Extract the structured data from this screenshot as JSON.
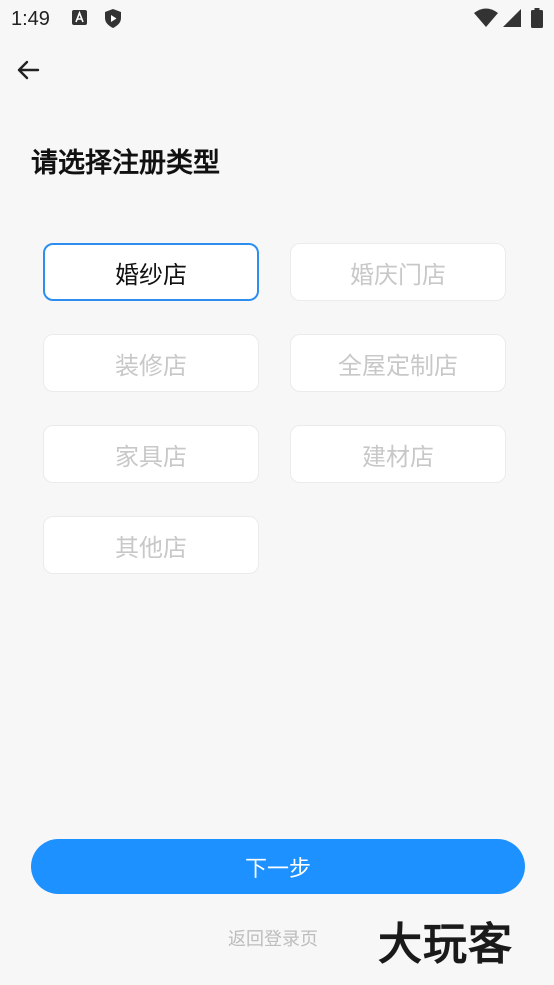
{
  "status_bar": {
    "time": "1:49",
    "icons": [
      "a-notification-icon",
      "play-protect-icon",
      "wifi-icon",
      "signal-icon",
      "battery-icon"
    ]
  },
  "header": {
    "back_icon": "arrow-left-icon"
  },
  "title": "请选择注册类型",
  "options": [
    {
      "label": "婚纱店",
      "selected": true
    },
    {
      "label": "婚庆门店",
      "selected": false
    },
    {
      "label": "装修店",
      "selected": false
    },
    {
      "label": "全屋定制店",
      "selected": false
    },
    {
      "label": "家具店",
      "selected": false
    },
    {
      "label": "建材店",
      "selected": false
    },
    {
      "label": "其他店",
      "selected": false
    }
  ],
  "next_button": "下一步",
  "back_to_login": "返回登录页",
  "watermark": "大玩客",
  "colors": {
    "accent": "#1c91ff",
    "selected_border": "#2d8ef0",
    "background": "#f7f7f7",
    "muted_text": "#c8c8c8"
  }
}
